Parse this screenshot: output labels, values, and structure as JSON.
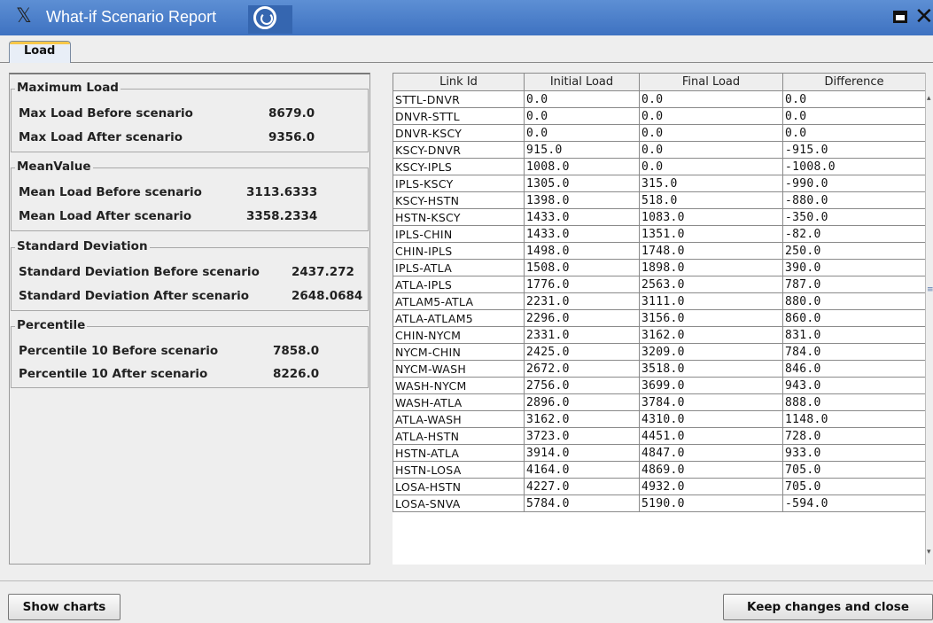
{
  "window": {
    "title": "What-if Scenario Report"
  },
  "tabs": [
    {
      "label": "Load"
    }
  ],
  "maximum_load": {
    "title": "Maximum Load",
    "before_label": "Max Load Before scenario",
    "before_value": "8679.0",
    "after_label": "Max Load After scenario",
    "after_value": "9356.0"
  },
  "mean_value": {
    "title": "MeanValue",
    "before_label": "Mean Load Before scenario",
    "before_value": "3113.6333",
    "after_label": "Mean Load After scenario",
    "after_value": "3358.2334"
  },
  "std_dev": {
    "title": "Standard Deviation",
    "before_label": "Standard Deviation Before scenario",
    "before_value": "2437.272",
    "after_label": "Standard Deviation After scenario",
    "after_value": "2648.0684"
  },
  "percentile": {
    "title": "Percentile",
    "before_label": "Percentile 10 Before scenario",
    "before_value": "7858.0",
    "after_label": "Percentile 10 After scenario",
    "after_value": "8226.0"
  },
  "table": {
    "columns": [
      "Link Id",
      "Initial Load",
      "Final Load",
      "Difference"
    ],
    "rows": [
      [
        "STTL-DNVR",
        "0.0",
        "0.0",
        "0.0"
      ],
      [
        "DNVR-STTL",
        "0.0",
        "0.0",
        "0.0"
      ],
      [
        "DNVR-KSCY",
        "0.0",
        "0.0",
        "0.0"
      ],
      [
        "KSCY-DNVR",
        "915.0",
        "0.0",
        "-915.0"
      ],
      [
        "KSCY-IPLS",
        "1008.0",
        "0.0",
        "-1008.0"
      ],
      [
        "IPLS-KSCY",
        "1305.0",
        "315.0",
        "-990.0"
      ],
      [
        "KSCY-HSTN",
        "1398.0",
        "518.0",
        "-880.0"
      ],
      [
        "HSTN-KSCY",
        "1433.0",
        "1083.0",
        "-350.0"
      ],
      [
        "IPLS-CHIN",
        "1433.0",
        "1351.0",
        "-82.0"
      ],
      [
        "CHIN-IPLS",
        "1498.0",
        "1748.0",
        "250.0"
      ],
      [
        "IPLS-ATLA",
        "1508.0",
        "1898.0",
        "390.0"
      ],
      [
        "ATLA-IPLS",
        "1776.0",
        "2563.0",
        "787.0"
      ],
      [
        "ATLAM5-ATLA",
        "2231.0",
        "3111.0",
        "880.0"
      ],
      [
        "ATLA-ATLAM5",
        "2296.0",
        "3156.0",
        "860.0"
      ],
      [
        "CHIN-NYCM",
        "2331.0",
        "3162.0",
        "831.0"
      ],
      [
        "NYCM-CHIN",
        "2425.0",
        "3209.0",
        "784.0"
      ],
      [
        "NYCM-WASH",
        "2672.0",
        "3518.0",
        "846.0"
      ],
      [
        "WASH-NYCM",
        "2756.0",
        "3699.0",
        "943.0"
      ],
      [
        "WASH-ATLA",
        "2896.0",
        "3784.0",
        "888.0"
      ],
      [
        "ATLA-WASH",
        "3162.0",
        "4310.0",
        "1148.0"
      ],
      [
        "ATLA-HSTN",
        "3723.0",
        "4451.0",
        "728.0"
      ],
      [
        "HSTN-ATLA",
        "3914.0",
        "4847.0",
        "933.0"
      ],
      [
        "HSTN-LOSA",
        "4164.0",
        "4869.0",
        "705.0"
      ],
      [
        "LOSA-HSTN",
        "4227.0",
        "4932.0",
        "705.0"
      ],
      [
        "LOSA-SNVA",
        "5784.0",
        "5190.0",
        "-594.0"
      ]
    ]
  },
  "buttons": {
    "show_charts": "Show charts",
    "keep_close": "Keep changes and close"
  },
  "icons": {
    "app": "x-logo-icon",
    "swirl": "swirl-icon",
    "maximize": "maximize-icon",
    "close": "close-icon"
  }
}
